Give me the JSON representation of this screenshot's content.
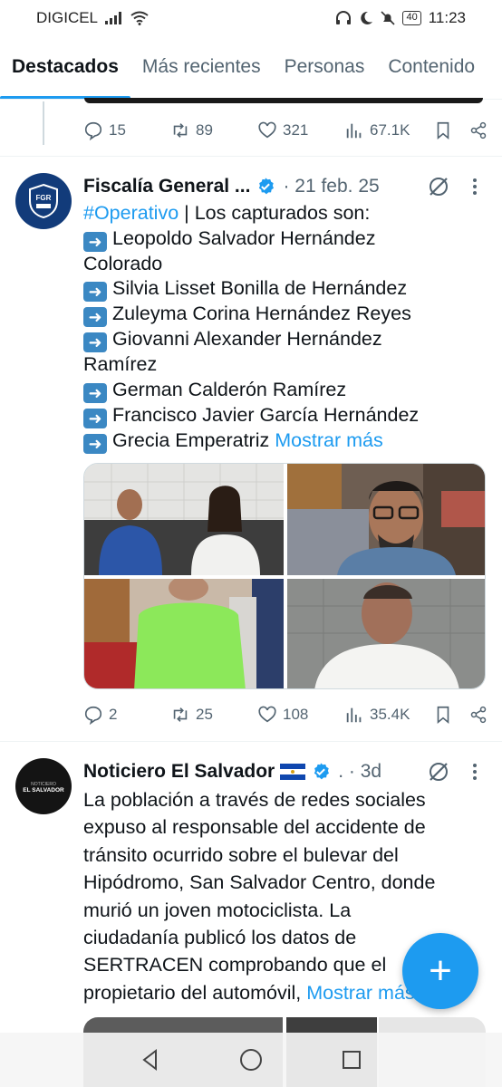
{
  "status_bar": {
    "carrier": "DIGICEL",
    "battery": "40",
    "time": "11:23"
  },
  "tabs": [
    {
      "label": "Destacados",
      "active": true
    },
    {
      "label": "Más recientes",
      "active": false
    },
    {
      "label": "Personas",
      "active": false
    },
    {
      "label": "Contenido",
      "active": false
    }
  ],
  "top_tweet_actions": {
    "replies": "15",
    "reposts": "89",
    "likes": "321",
    "views": "67.1K"
  },
  "tweet1": {
    "avatar_text": "FGR",
    "name": "Fiscalía General ...",
    "meta": "· 21 feb. 25",
    "hashtag": "#Operativo",
    "intro": " | Los capturados son:",
    "arrow": "➡️",
    "lines": [
      "Leopoldo Salvador Hernández",
      "Colorado",
      "Silvia Lisset Bonilla de Hernández",
      "Zuleyma Corina Hernández Reyes",
      "Giovanni Alexander Hernández",
      "Ramírez",
      "German Calderón Ramírez",
      "Francisco Javier García Hernández",
      "Grecia Emperatriz"
    ],
    "show_more": "Mostrar más",
    "actions": {
      "replies": "2",
      "reposts": "25",
      "likes": "108",
      "views": "35.4K"
    }
  },
  "tweet2": {
    "avatar_line1": "NOTICIERO",
    "avatar_line2": "EL SALVADOR",
    "name": "Noticiero El Salvador",
    "meta": ". · 3d",
    "lines": [
      "La población a través de redes sociales",
      "expuso al responsable del accidente de",
      "tránsito ocurrido sobre el bulevar del",
      "Hipódromo, San Salvador Centro, donde",
      "murió un joven motociclista. La",
      "ciudadanía publicó los datos de",
      "SERTRACEN comprobando que el",
      "propietario del automóvil,"
    ],
    "show_more": "Mostrar más"
  },
  "fab_label": "+",
  "colors": {
    "accent": "#1d9bf0",
    "secondary_text": "#536471"
  }
}
